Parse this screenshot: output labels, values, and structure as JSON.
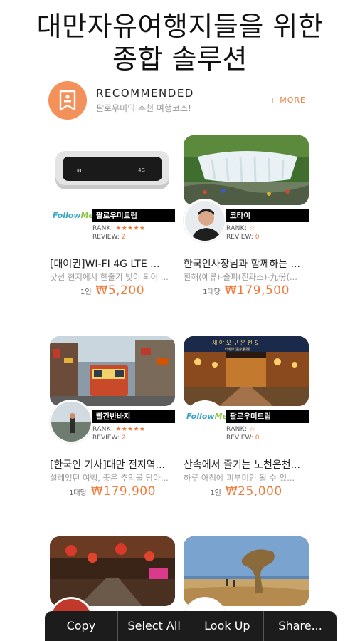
{
  "headline": {
    "line1": "대만자유여행지들을 위한",
    "line2": "종합 솔루션"
  },
  "recommended": {
    "title": "RECOMMENDED",
    "subtitle": "팔로우미의 추천 여행코스!",
    "more": "+ MORE"
  },
  "cards": [
    {
      "seller": "팔로우미트립",
      "rank_label": "RANK:",
      "stars": "★★★★★",
      "review_label": "REVIEW:",
      "review_count": "2",
      "title": "[대여권]WI-FI 4G LTE ...",
      "desc": "낯선 현지에서 한줄기 빛이 되어 ...",
      "unit": "1인",
      "price": "₩5,200",
      "logo_a": "Follow",
      "logo_b": "MeTrip"
    },
    {
      "seller": "코타이",
      "rank_label": "RANK:",
      "stars": "☆",
      "review_label": "REVIEW:",
      "review_count": "0",
      "title": "한국인사장님과 함께하는 ...",
      "desc": "환해(예류)-솔피(진과스)-九份(...",
      "unit": "1대당",
      "price": "₩179,500"
    },
    {
      "seller": "빨간반바지",
      "rank_label": "RANK:",
      "stars": "★★★★★",
      "review_label": "REVIEW:",
      "review_count": "2",
      "title": "[한국인 기사]대만 전지역...",
      "desc": "설레었던 여행, 좋은 추억을 담아...",
      "unit": "1대당",
      "price": "₩179,900"
    },
    {
      "seller": "팔로우미트립",
      "rank_label": "RANK:",
      "stars": "☆",
      "review_label": "REVIEW:",
      "review_count": "0",
      "title": "산속에서 즐기는 노천온천...",
      "desc": "하루 아침에 피부미인 될 수 있...",
      "unit": "1인",
      "price": "₩25,000",
      "logo_a": "Follow",
      "logo_b": "MeTrip",
      "sign_text": "새 야 오 구 온 천 &",
      "sign_sub": "紗帽山溫泉餐廳"
    }
  ],
  "context_menu": {
    "copy": "Copy",
    "select_all": "Select All",
    "look_up": "Look Up",
    "share": "Share..."
  },
  "colors": {
    "accent": "#f07a3a",
    "badge": "#f4915a",
    "menu_bg": "#1c1c1c"
  }
}
